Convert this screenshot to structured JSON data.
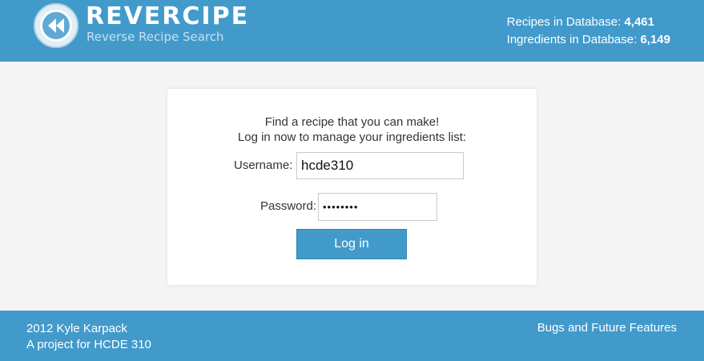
{
  "header": {
    "brand_title": "REVERCIPE",
    "brand_subtitle": "Reverse Recipe Search",
    "logo_icon": "rewind-icon",
    "stats": {
      "recipes_label": "Recipes in Database:",
      "recipes_value": "4,461",
      "ingredients_label": "Ingredients in Database:",
      "ingredients_value": "6,149"
    }
  },
  "login": {
    "intro_line1": "Find a recipe that you can make!",
    "intro_line2": "Log in now to manage your ingredients list:",
    "username_label": "Username:",
    "username_value": "hcde310",
    "password_label": "Password:",
    "password_value": "••••••••",
    "submit_label": "Log in"
  },
  "footer": {
    "copyright": "2012 Kyle Karpack",
    "project": "A project for HCDE 310",
    "link_label": "Bugs and Future Features"
  },
  "colors": {
    "brand_blue": "#429acb",
    "background": "#f4f4f4",
    "card": "#ffffff"
  }
}
